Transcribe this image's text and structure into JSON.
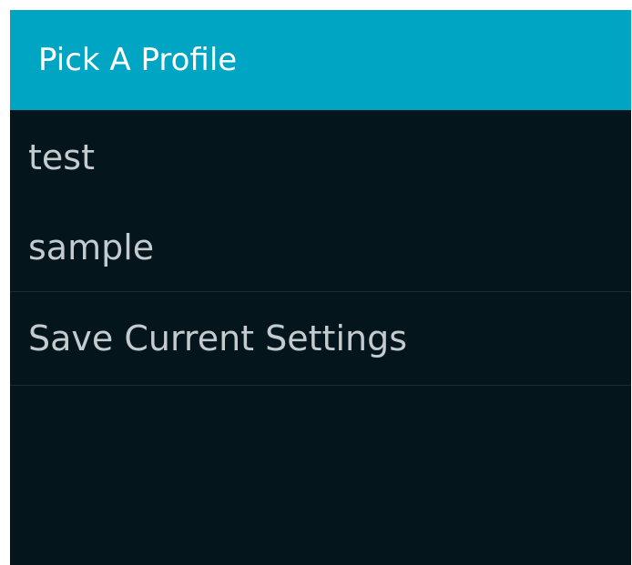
{
  "dialog": {
    "title": "Pick A Profile",
    "items": [
      {
        "label": "test"
      },
      {
        "label": "sample"
      },
      {
        "label": "Save Current Settings"
      }
    ]
  },
  "colors": {
    "header_bg": "#00a5c4",
    "body_bg": "#04151c",
    "item_text": "#c3cbcf",
    "header_text": "#ffffff"
  }
}
